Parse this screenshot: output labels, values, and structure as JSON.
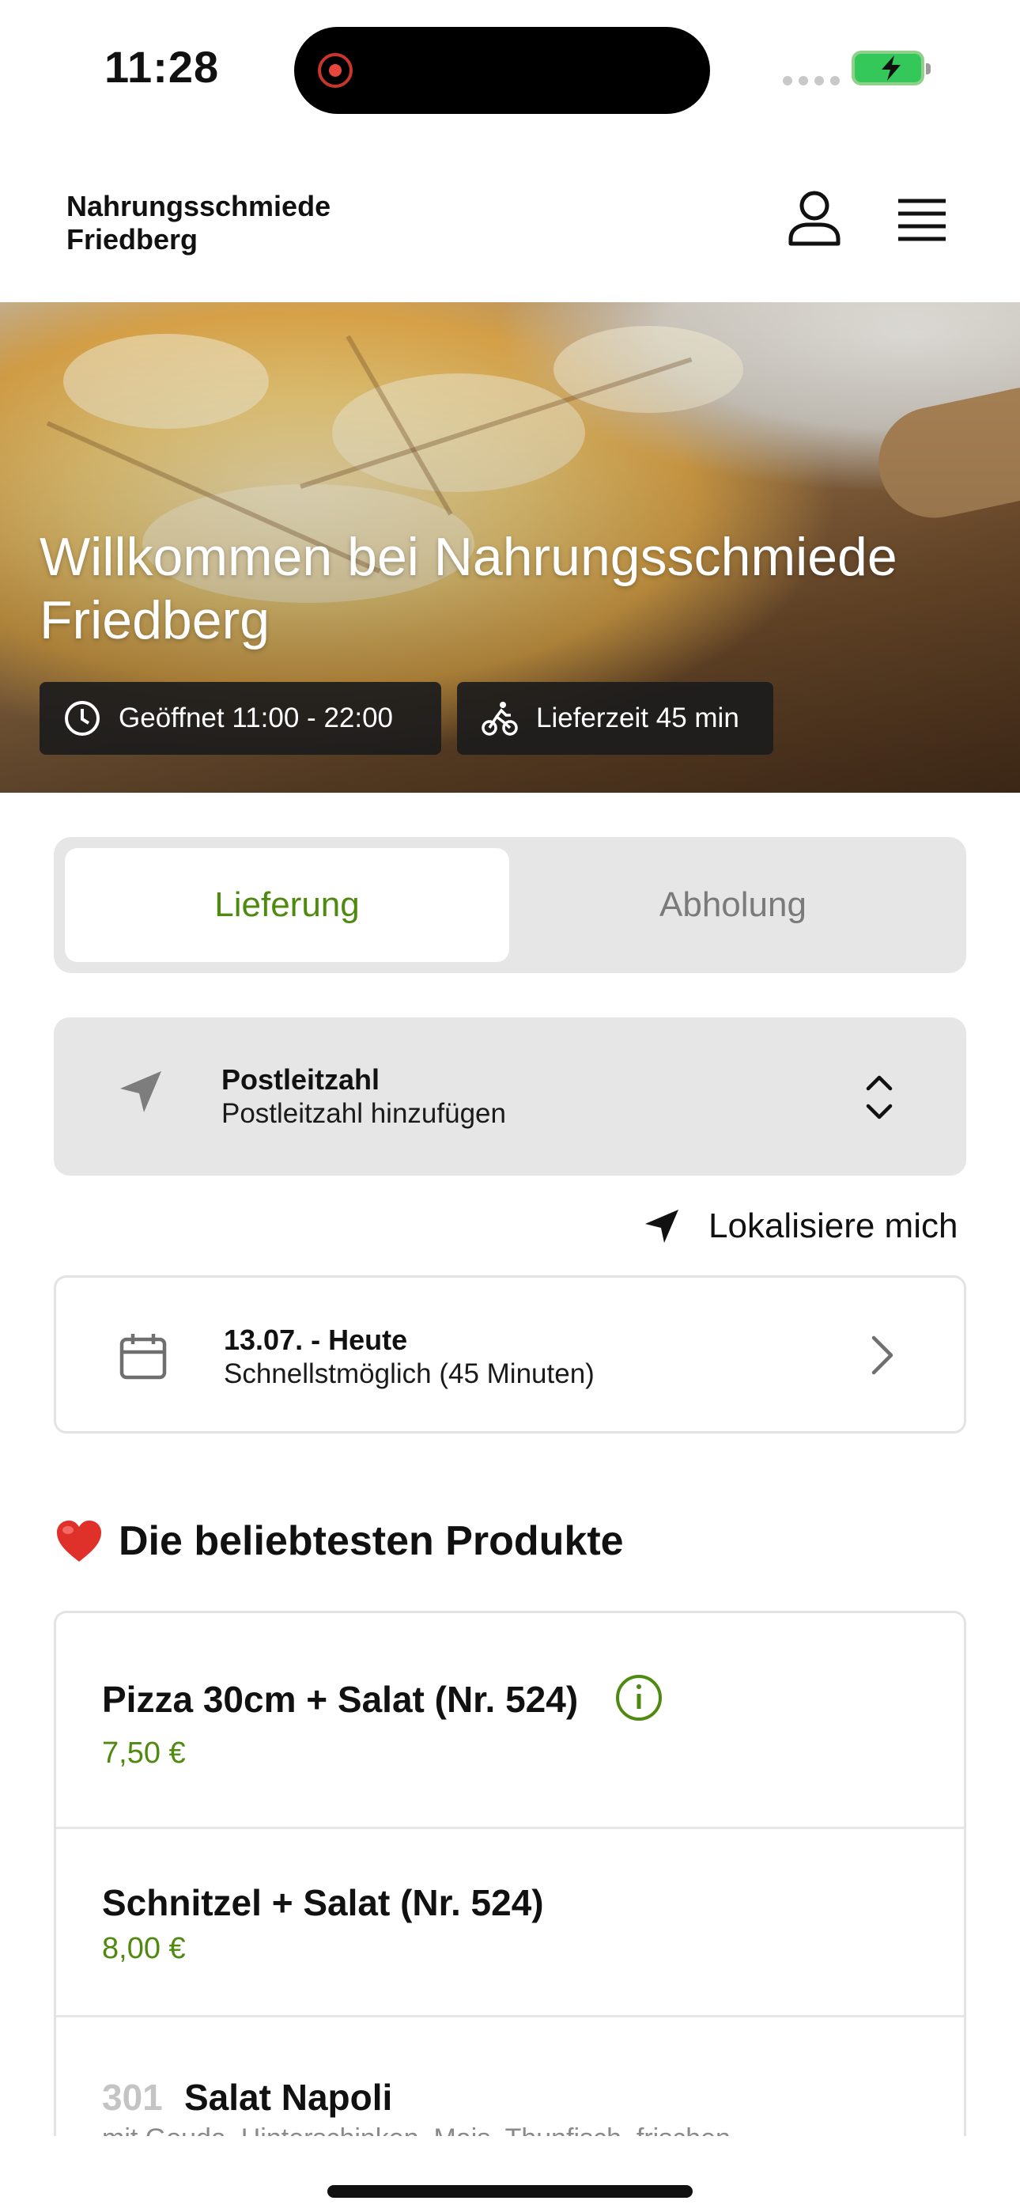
{
  "status_bar": {
    "time": "11:28",
    "icons": [
      "recording-indicator-icon",
      "signal-dots-icon",
      "battery-charging-icon"
    ],
    "colors": {
      "recording": "#e8453c",
      "battery": "#34c759"
    }
  },
  "header": {
    "brand_line1": "Nahrungsschmiede",
    "brand_line2": "Friedberg",
    "icons": [
      "user-icon",
      "hamburger-menu-icon"
    ]
  },
  "hero": {
    "title": "Willkommen bei Nahrungsschmiede Friedberg",
    "opening_hours": "Geöffnet 11:00 - 22:00",
    "delivery_time": "Lieferzeit 45 min",
    "icons": [
      "clock-icon",
      "bicycle-icon"
    ]
  },
  "mode_toggle": {
    "delivery_label": "Lieferung",
    "pickup_label": "Abholung",
    "selected": "Lieferung",
    "accent_color": "#4f8a10"
  },
  "postcode": {
    "title": "Postleitzahl",
    "placeholder": "Postleitzahl hinzufügen",
    "icons": [
      "navigation-arrow-icon",
      "chevron-up-down-icon"
    ]
  },
  "locate": {
    "label": "Lokalisiere mich"
  },
  "schedule": {
    "date": "13.07. - Heute",
    "time": "Schnellstmöglich (45 Minuten)",
    "icons": [
      "calendar-icon",
      "chevron-right-icon"
    ]
  },
  "popular": {
    "title": "Die beliebtesten Produkte",
    "emoji": "❤️",
    "items": [
      {
        "name": "Pizza 30cm + Salat (Nr. 524)",
        "price": "7,50 €",
        "has_info": true
      },
      {
        "name": "Schnitzel + Salat (Nr. 524)",
        "price": "8,00 €"
      },
      {
        "number": "301",
        "name": "Salat Napoli",
        "description": "mit Gouda, Hinterschinken, Mais, Thunfisch, frischen"
      }
    ]
  }
}
